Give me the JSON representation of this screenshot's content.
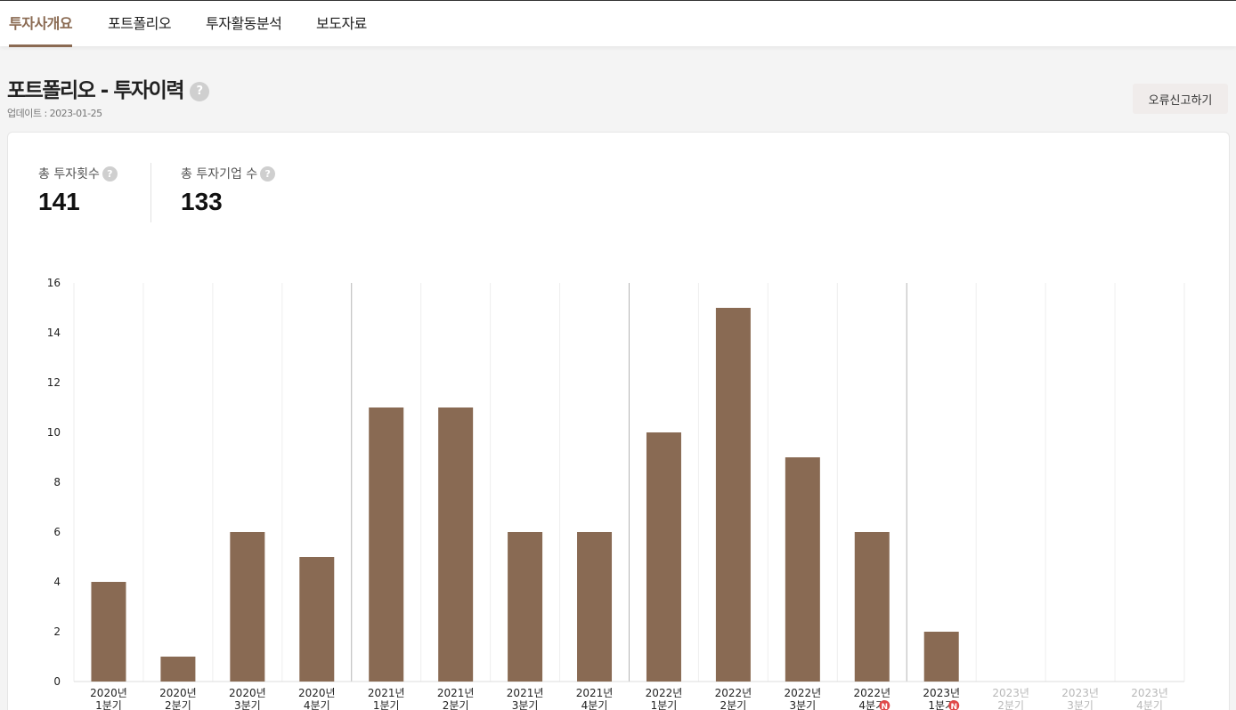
{
  "tabs": [
    {
      "label": "투자사개요",
      "active": true
    },
    {
      "label": "포트폴리오",
      "active": false
    },
    {
      "label": "투자활동분석",
      "active": false
    },
    {
      "label": "보도자료",
      "active": false
    }
  ],
  "page": {
    "title": "포트폴리오 - 투자이력",
    "update": "업데이트 : 2023-01-25",
    "report_button": "오류신고하기",
    "help_glyph": "?"
  },
  "stats": [
    {
      "label": "총 투자횟수",
      "value": "141"
    },
    {
      "label": "총 투자기업 수",
      "value": "133"
    }
  ],
  "chart_data": {
    "type": "bar",
    "categories": [
      {
        "year": "2020년",
        "quarter": "1분기"
      },
      {
        "year": "2020년",
        "quarter": "2분기"
      },
      {
        "year": "2020년",
        "quarter": "3분기"
      },
      {
        "year": "2020년",
        "quarter": "4분기"
      },
      {
        "year": "2021년",
        "quarter": "1분기"
      },
      {
        "year": "2021년",
        "quarter": "2분기"
      },
      {
        "year": "2021년",
        "quarter": "3분기"
      },
      {
        "year": "2021년",
        "quarter": "4분기"
      },
      {
        "year": "2022년",
        "quarter": "1분기"
      },
      {
        "year": "2022년",
        "quarter": "2분기"
      },
      {
        "year": "2022년",
        "quarter": "3분기"
      },
      {
        "year": "2022년",
        "quarter": "4분기",
        "new": true
      },
      {
        "year": "2023년",
        "quarter": "1분기",
        "new": true
      },
      {
        "year": "2023년",
        "quarter": "2분기",
        "future": true
      },
      {
        "year": "2023년",
        "quarter": "3분기",
        "future": true
      },
      {
        "year": "2023년",
        "quarter": "4분기",
        "future": true
      }
    ],
    "values": [
      4,
      1,
      6,
      5,
      11,
      11,
      6,
      6,
      10,
      15,
      9,
      6,
      2,
      null,
      null,
      null
    ],
    "ylim": [
      0,
      16
    ],
    "yticks": [
      0,
      2,
      4,
      6,
      8,
      10,
      12,
      14,
      16
    ],
    "year_separators_before": [
      4,
      8,
      12
    ],
    "new_badge": "N",
    "bar_color": "#896a53",
    "badge_color": "#e04848",
    "future_label_color": "#b8b8b8",
    "grid": true,
    "legend": "none"
  }
}
